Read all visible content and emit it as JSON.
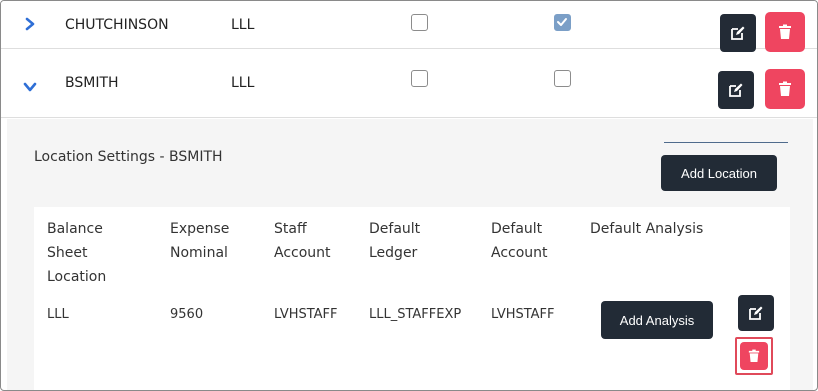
{
  "users": [
    {
      "username": "CHUTCHINSON",
      "location": "LLL",
      "checkbox_1": false,
      "checkbox_2": true,
      "expanded": false,
      "toggle_icon": "chevron-right-icon"
    },
    {
      "username": "BSMITH",
      "location": "LLL",
      "checkbox_1": false,
      "checkbox_2": false,
      "expanded": true,
      "toggle_icon": "chevron-down-icon"
    }
  ],
  "location_settings": {
    "title": "Location Settings - BSMITH",
    "add_location_label": "Add Location",
    "headers": [
      "Balance Sheet Location",
      "Expense Nominal",
      "Staff Account",
      "Default Ledger",
      "Default Account",
      "Default Analysis"
    ],
    "header_lines": [
      [
        "Balance",
        "Sheet",
        "Location"
      ],
      [
        "Expense",
        "Nominal"
      ],
      [
        "Staff",
        "Account"
      ],
      [
        "Default",
        "Ledger"
      ],
      [
        "Default",
        "Account"
      ],
      [
        "Default Analysis"
      ]
    ],
    "rows": [
      {
        "balance_sheet_location": "LLL",
        "expense_nominal": "9560",
        "staff_account": "LVHSTAFF",
        "default_ledger": "LLL_STAFFEXP",
        "default_account": "LVHSTAFF",
        "add_analysis_label": "Add Analysis"
      }
    ]
  },
  "icons": {
    "edit": "edit-icon",
    "delete": "trash-icon",
    "expand": "chevron-right-icon",
    "collapse": "chevron-down-icon"
  },
  "colors": {
    "dark_button": "#232b36",
    "delete_button": "#ef4560",
    "chevron": "#2f6fd6",
    "checked": "#7b9fc7",
    "panel_bg": "#f5f5f5",
    "highlight_border": "#e04a5a"
  }
}
